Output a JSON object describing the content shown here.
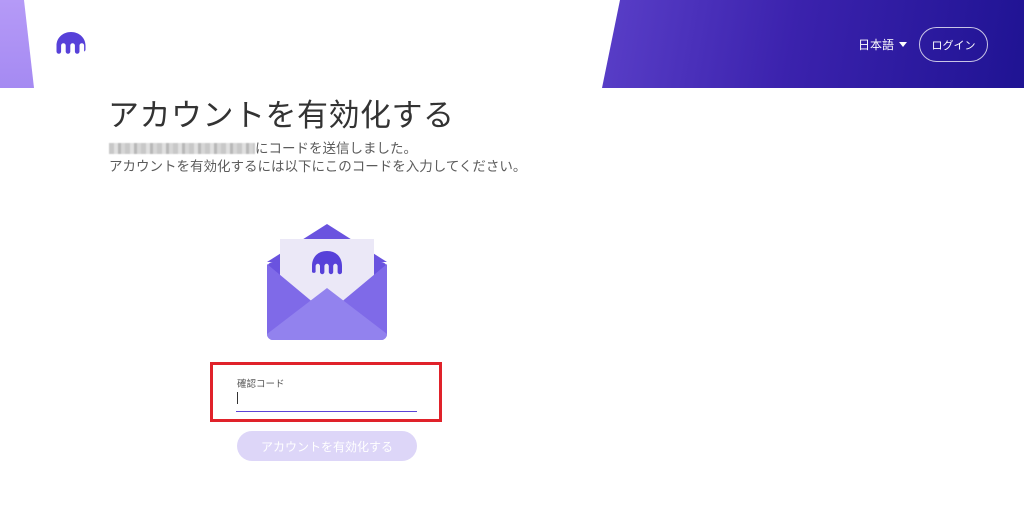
{
  "header": {
    "language_label": "日本語",
    "login_label": "ログイン"
  },
  "main": {
    "title": "アカウントを有効化する",
    "email_masked": "",
    "sent_text": "にコードを送信しました。",
    "instruction_text": "アカウントを有効化するには以下にこのコードを入力してください。",
    "code_field_label": "確認コード",
    "code_value": "",
    "activate_button_label": "アカウントを有効化する"
  },
  "icons": {
    "logo": "kraken-logo-icon",
    "envelope": "envelope-icon",
    "caret": "caret-down-icon"
  },
  "colors": {
    "brand_purple": "#5741d9",
    "header_dark": "#1f1393",
    "highlight_red": "#e0222a",
    "button_disabled": "#ddd6f8"
  }
}
